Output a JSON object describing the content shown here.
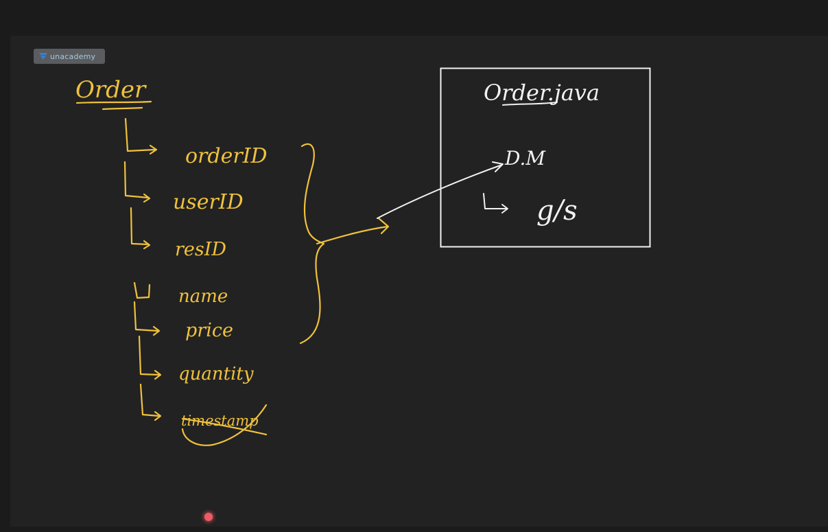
{
  "brand": {
    "name": "unacademy",
    "icon": "unacademy-logo-icon"
  },
  "board": {
    "title": "Order",
    "fields": [
      "orderID",
      "userID",
      "resID",
      "name",
      "price",
      "quantity",
      "timestamp"
    ],
    "struck_field": "timestamp",
    "box": {
      "title": "Order.java",
      "line1": "D.M",
      "line2": "g/s"
    }
  },
  "colors": {
    "background": "#1b1b1c",
    "canvas": "#222223",
    "ink_yellow": "#f0c23c",
    "ink_white": "#f2f2f2",
    "pointer": "#f05b63"
  }
}
